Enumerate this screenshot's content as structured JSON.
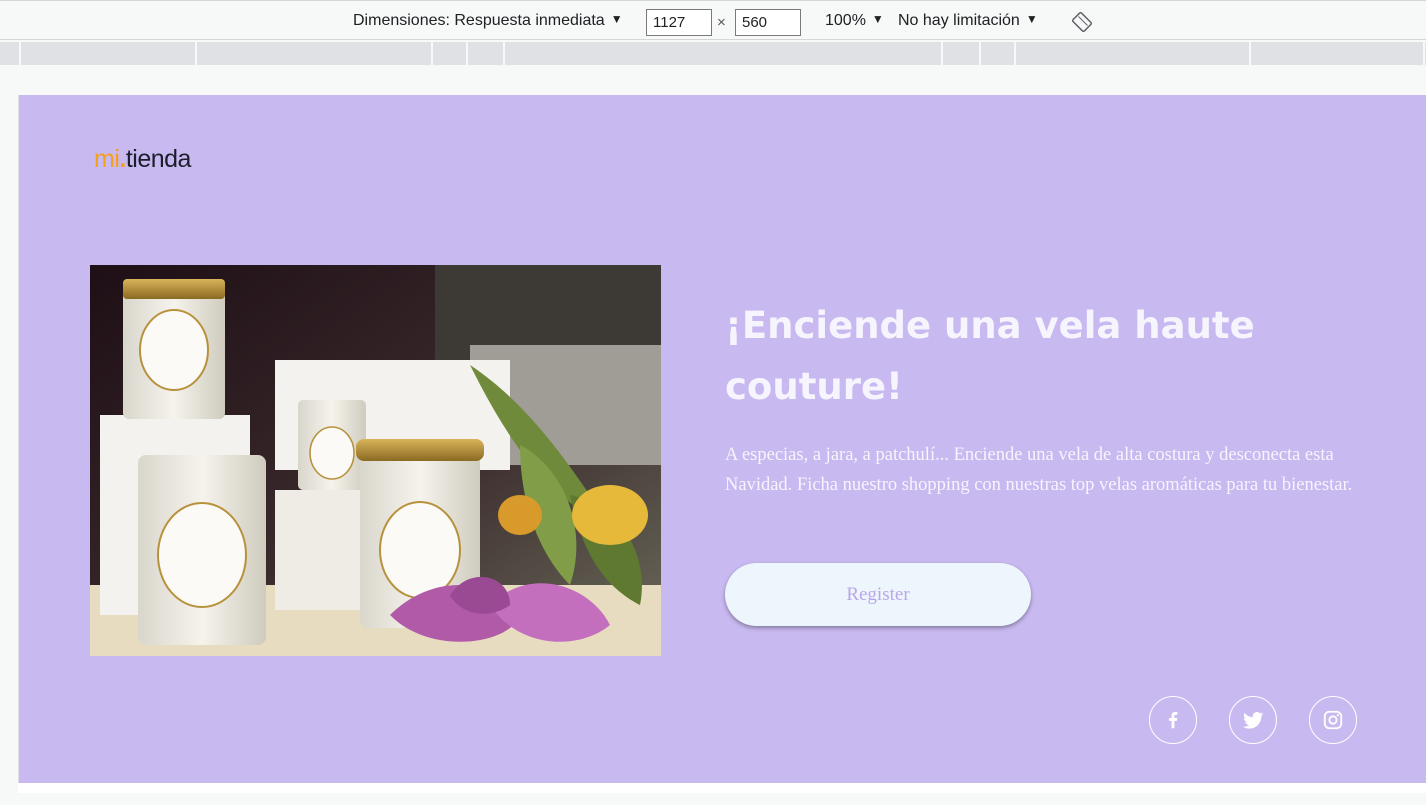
{
  "devtools": {
    "dimensions_label": "Dimensiones: Respuesta inmediata",
    "width_value": "1127",
    "height_value": "560",
    "times": "×",
    "zoom": "100%",
    "throttling": "No hay limitación",
    "caret": "▼",
    "icons": {
      "rotate": "rotate-icon"
    }
  },
  "page": {
    "logo": {
      "mi": "mi",
      "dot": ".",
      "tienda": "tienda"
    },
    "headline": "¡Enciende una vela haute couture!",
    "body": "A especias, a jara, a patchulí... Enciende una vela de alta costura y desconecta esta Navidad. Ficha nuestro shopping con nuestras top velas aromáticas para tu bienestar.",
    "register_label": "Register",
    "social": [
      "facebook-icon",
      "twitter-icon",
      "instagram-icon"
    ],
    "colors": {
      "background": "#c9b9f1",
      "headline": "#f6f4fd",
      "button_bg": "#eef6fd",
      "button_text": "#b9a6ea",
      "logo_accent": "#f5a01c"
    }
  }
}
